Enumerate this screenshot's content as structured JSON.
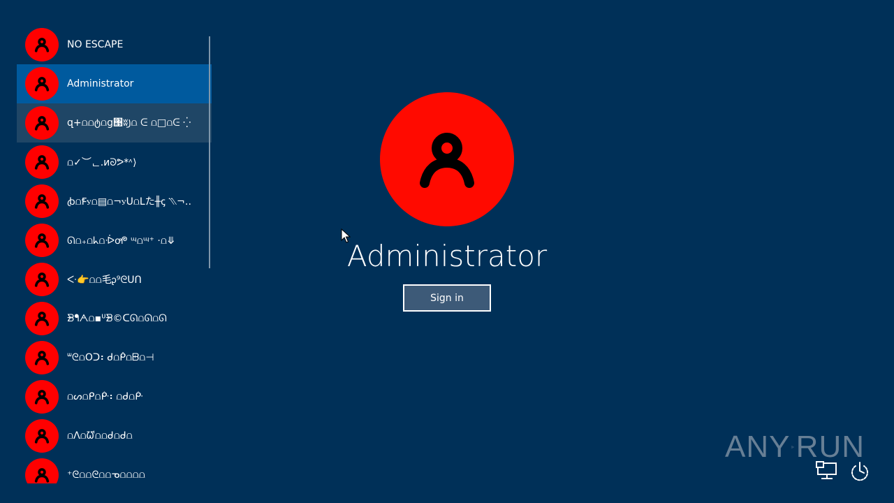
{
  "users": [
    {
      "name": "NO ESCAPE",
      "state": "normal"
    },
    {
      "name": "Administrator",
      "state": "selected"
    },
    {
      "name": "զ+⩍⩍ტ⩍ց঩ʬ꠸⩍ ᕮ ⩍□⩍ᕮ ⁛",
      "state": "hovered"
    },
    {
      "name": "⩍✓︶ᆫ.ᴎᘐᕗ*ᶺ⟩",
      "state": "normal"
    },
    {
      "name": "ꞗ⩍Ꞙꭹ⩍▤⩍¬ꭹᑌ⩍ᒪた╫ꞔ ⳹¬‥",
      "state": "normal"
    },
    {
      "name": "ᘏ⩍₊⩍ᖾ⩍ᐔꝍᖘ ᶭ⩍ᶭ⁺ ·⩍⤋",
      "state": "normal"
    },
    {
      "name": "ᑅ👉⩍⩍毛ᶗ⁹ᘓᑌᑎ",
      "state": "normal"
    },
    {
      "name": "ᗾᖳᗅ⩍▪ᓑᗾ©ᑕᘏ⩍ᘏ⩍ᘏ",
      "state": "normal"
    },
    {
      "name": "ᐜᘓ⩍Oᑐ⠆ᑰ⩍ᑬ⩍ᗸ⩍⊣",
      "state": "normal"
    },
    {
      "name": "⩍ᔕ⩍ᑭ⩍ᑹ⠆⩍ᑯ⩍ᑹ",
      "state": "normal"
    },
    {
      "name": "⩍ᐱ⩍ᘺ⩍⩍ᑯ⩍ᑰ⩍",
      "state": "normal"
    },
    {
      "name": "⁺ᘓ⩍⩍ᘓ⩍⩍ᓀ⩍⩍⩍⩍",
      "state": "normal"
    }
  ],
  "main": {
    "selected_user": "Administrator",
    "sign_in_label": "Sign in"
  },
  "watermark": {
    "left_text": "ANY",
    "right_text": "RUN"
  },
  "icons": {
    "avatar": "user-icon",
    "network": "network-icon",
    "power": "power-icon"
  },
  "colors": {
    "background": "#003058",
    "avatar": "#ff0000",
    "selected_row": "#005a9e",
    "hovered_row": "#1f4666",
    "sign_in_bg": "#3d5a78"
  }
}
